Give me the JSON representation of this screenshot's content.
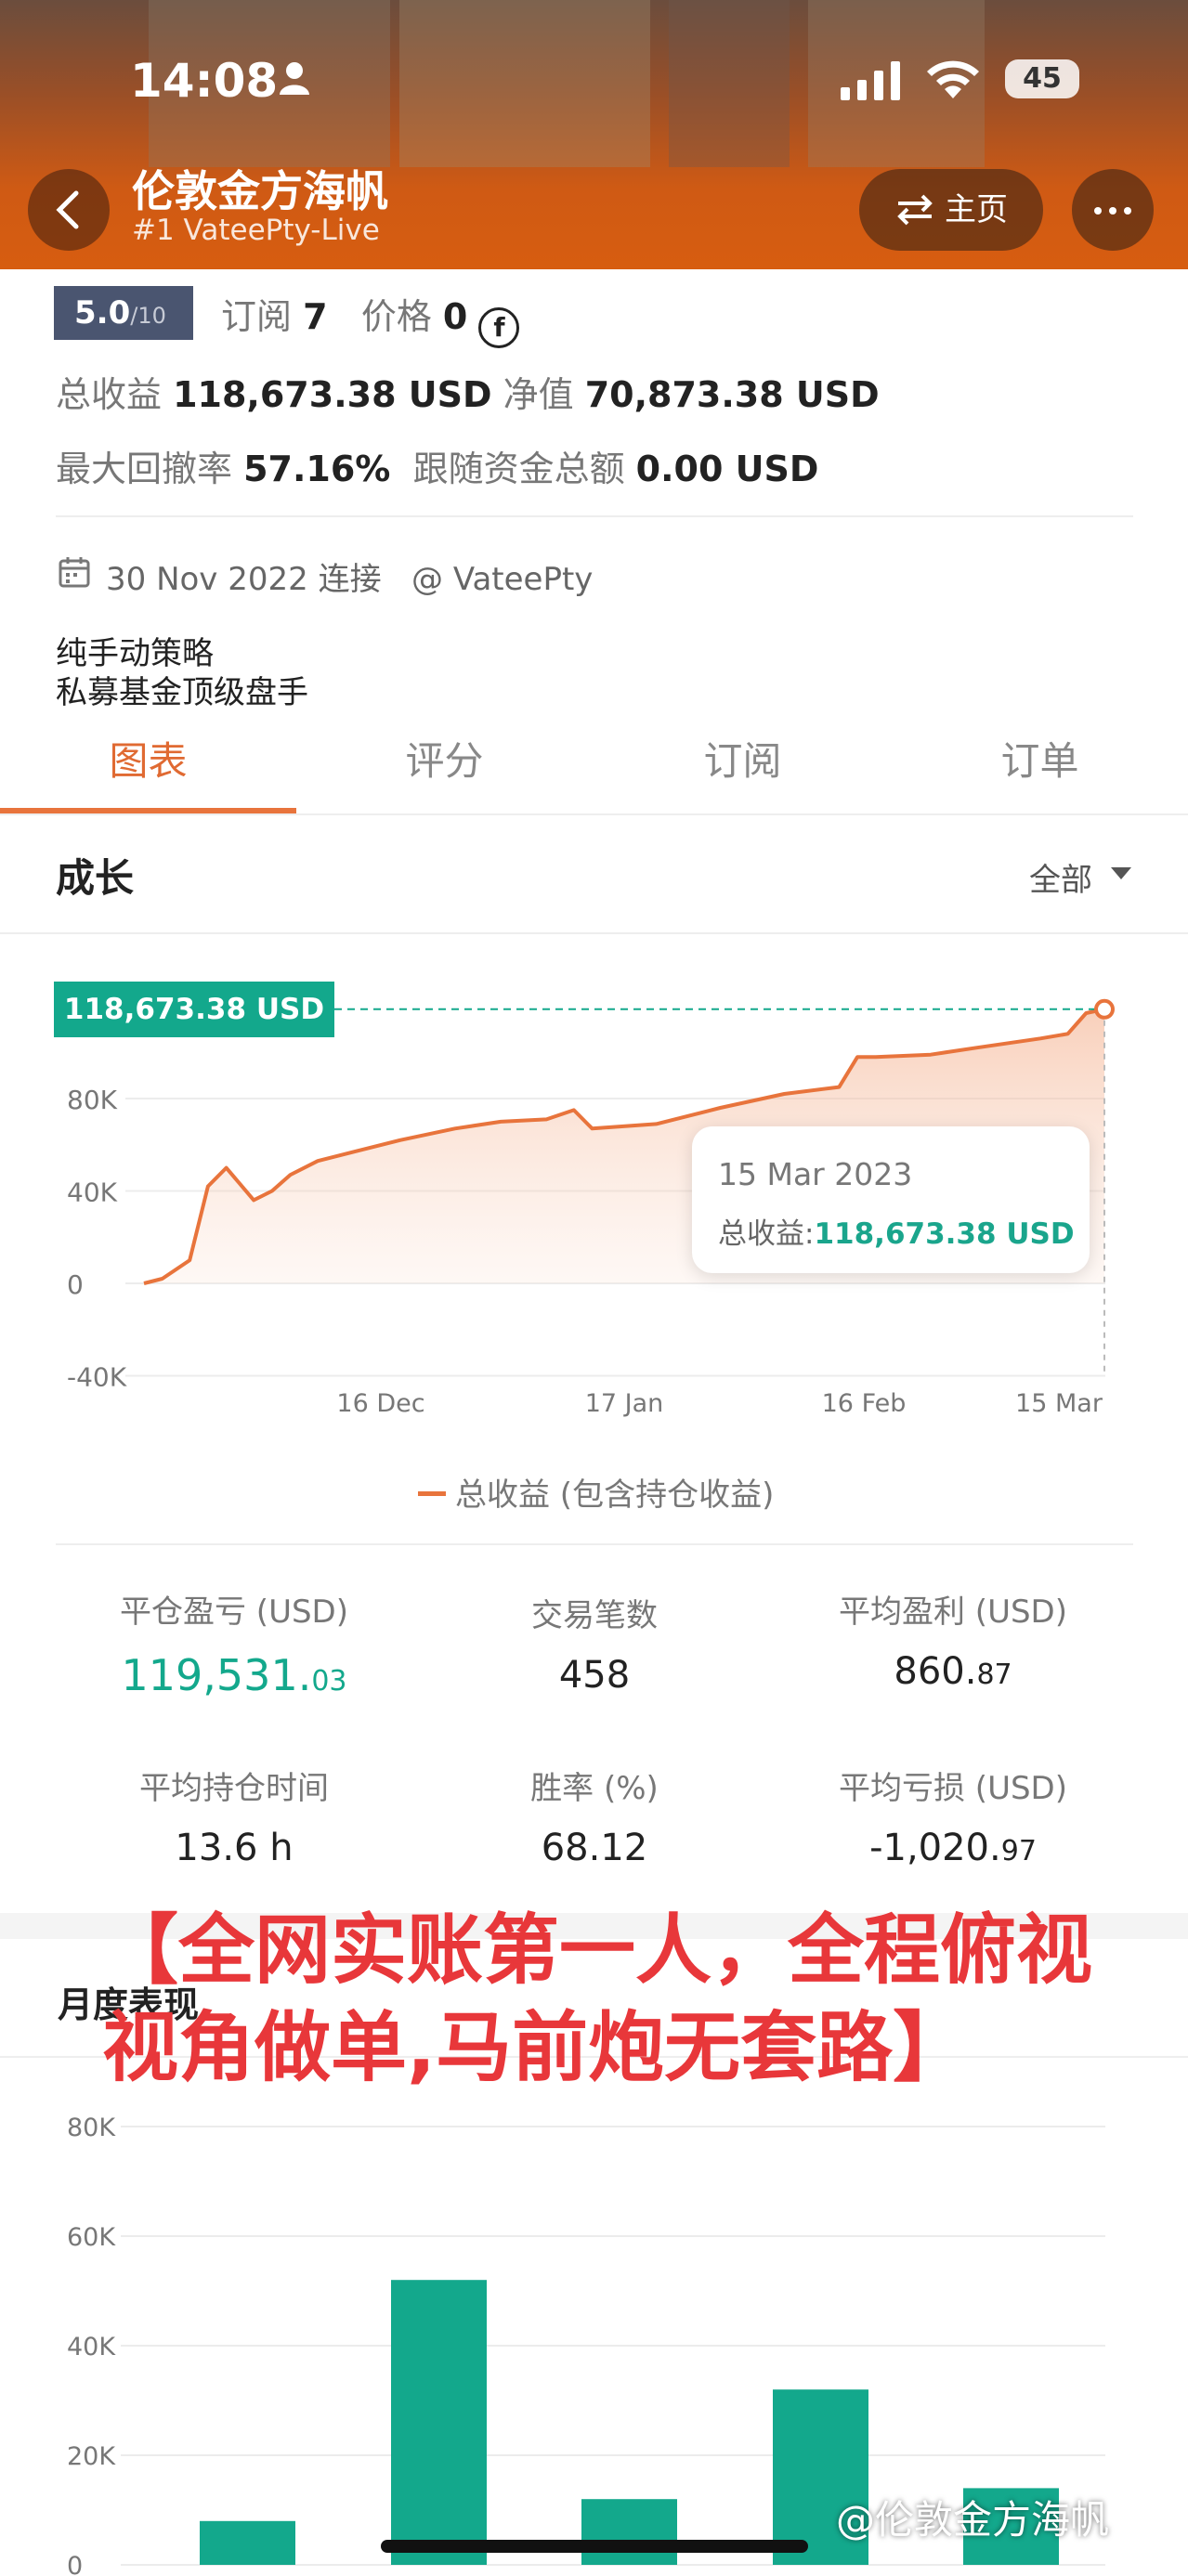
{
  "status_bar": {
    "time": "14:08",
    "battery": "45"
  },
  "header": {
    "title": "伦敦金方海帆",
    "subtitle": "#1 VateePty-Live",
    "home_label": "主页"
  },
  "info": {
    "score": "5.0",
    "score_max": "/10",
    "subscribe_label": "订阅",
    "subscribe_count": "7",
    "price_label": "价格",
    "price_value": "0",
    "total_profit_label": "总收益",
    "total_profit_value": "118,673.38 USD",
    "equity_label": "净值",
    "equity_value": "70,873.38 USD",
    "drawdown_label": "最大回撤率",
    "drawdown_value": "57.16%",
    "follow_label": "跟随资金总额",
    "follow_value": "0.00 USD",
    "join_date": "30 Nov 2022 连接",
    "handle": "@ VateePty",
    "desc_line1": "纯手动策略",
    "desc_line2": "私募基金顶级盘手"
  },
  "tabs": [
    "图表",
    "评分",
    "订阅",
    "订单"
  ],
  "growth": {
    "title": "成长",
    "filter": "全部",
    "flag_value": "118,673.38 USD",
    "tooltip_date": "15 Mar 2023",
    "tooltip_label": "总收益:",
    "tooltip_value": "118,673.38 USD",
    "legend": "总收益 (包含持仓收益)"
  },
  "chart_data": [
    {
      "type": "area",
      "x": [
        "2022-11-30",
        "2022-12-02",
        "2022-12-05",
        "2022-12-07",
        "2022-12-09",
        "2022-12-12",
        "2022-12-14",
        "2022-12-16",
        "2022-12-19",
        "2022-12-23",
        "2022-12-28",
        "2023-01-03",
        "2023-01-08",
        "2023-01-13",
        "2023-01-16",
        "2023-01-18",
        "2023-01-25",
        "2023-02-01",
        "2023-02-08",
        "2023-02-14",
        "2023-02-16",
        "2023-02-18",
        "2023-02-24",
        "2023-03-01",
        "2023-03-08",
        "2023-03-11",
        "2023-03-13",
        "2023-03-15"
      ],
      "values": [
        0,
        2000,
        10000,
        42000,
        50000,
        36000,
        40000,
        47000,
        53000,
        57000,
        62000,
        67000,
        70000,
        71000,
        75000,
        67000,
        69000,
        76000,
        82000,
        85000,
        98000,
        98000,
        99000,
        102000,
        106000,
        108000,
        117000,
        118673.38
      ],
      "xticks": [
        "16 Dec",
        "17 Jan",
        "16 Feb",
        "15 Mar"
      ],
      "yticks": [
        "80K",
        "40K",
        "0",
        "-40K"
      ],
      "ylim": [
        -40000,
        130000
      ],
      "grid": true,
      "legend": "bottom-center",
      "color": "#e8743c"
    },
    {
      "type": "bar",
      "values": [
        8000,
        52000,
        12000,
        32000,
        14000
      ],
      "yticks": [
        "80K",
        "60K",
        "40K",
        "20K",
        "0"
      ],
      "ylim": [
        0,
        80000
      ],
      "color": "#13a88c"
    }
  ],
  "stats": [
    {
      "label": "平仓盈亏 (USD)",
      "main": "119,531.",
      "small": "03",
      "green": true
    },
    {
      "label": "交易笔数",
      "main": "458",
      "small": ""
    },
    {
      "label": "平均盈利 (USD)",
      "main": "860.",
      "small": "87"
    },
    {
      "label": "平均持仓时间",
      "main": "13.6 h",
      "small": ""
    },
    {
      "label": "胜率 (%)",
      "main": "68.12",
      "small": ""
    },
    {
      "label": "平均亏损 (USD)",
      "main": "-1,020.",
      "small": "97"
    }
  ],
  "monthly": {
    "title": "月度表现"
  },
  "overlay": "【全网实账第一人，全程俯视视角做单,马前炮无套路】",
  "watermark": "@伦敦金方海帆"
}
